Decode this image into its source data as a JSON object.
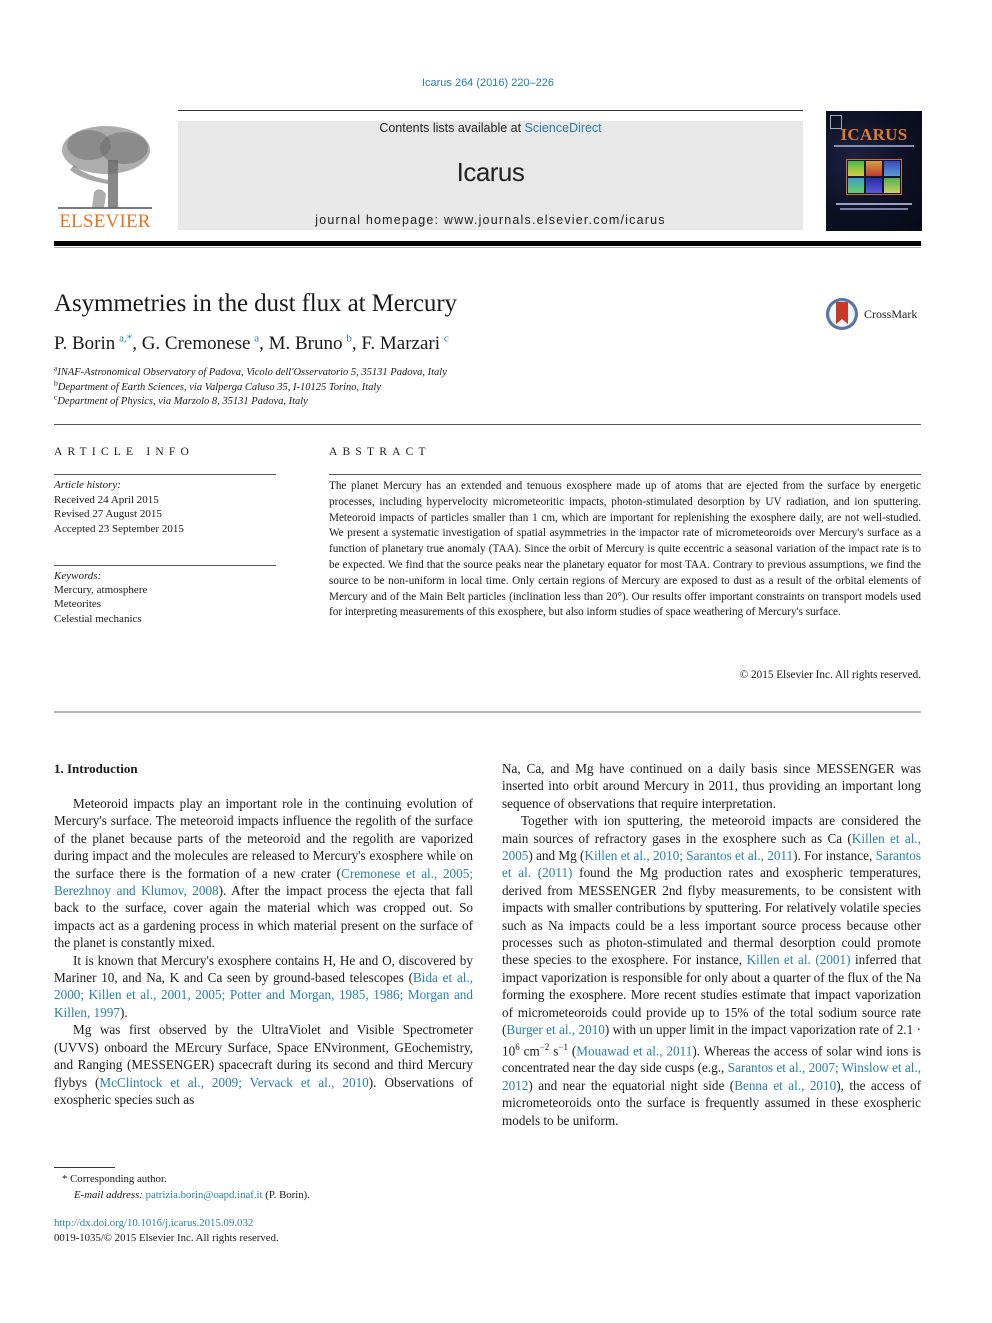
{
  "header": {
    "citation": "Icarus 264 (2016) 220–226",
    "contents_prefix": "Contents lists available at ",
    "contents_link": "ScienceDirect",
    "journal_name": "Icarus",
    "homepage": "journal homepage: www.journals.elsevier.com/icarus",
    "publisher_logo_text": "ELSEVIER",
    "cover_title": "ICARUS",
    "colors": {
      "link": "#2a7fa8",
      "elsevier_orange": "#e9711c",
      "banner_bg": "#e8e8e8"
    }
  },
  "article": {
    "title": "Asymmetries in the dust flux at Mercury",
    "crossmark_label": "CrossMark",
    "authors": [
      {
        "name": "P. Borin",
        "sup": "a,*"
      },
      {
        "name": "G. Cremonese",
        "sup": "a"
      },
      {
        "name": "M. Bruno",
        "sup": "b"
      },
      {
        "name": "F. Marzari",
        "sup": "c"
      }
    ],
    "affiliations": [
      {
        "key": "a",
        "text": "INAF-Astronomical Observatory of Padova, Vicolo dell'Osservatorio 5, 35131 Padova, Italy"
      },
      {
        "key": "b",
        "text": "Department of Earth Sciences, via Valperga Caluso 35, I-10125 Torino, Italy"
      },
      {
        "key": "c",
        "text": "Department of Physics, via Marzolo 8, 35131 Padova, Italy"
      }
    ]
  },
  "article_info": {
    "heading": "ARTICLE INFO",
    "history_label": "Article history:",
    "history": [
      "Received 24 April 2015",
      "Revised 27 August 2015",
      "Accepted 23 September 2015"
    ],
    "keywords_label": "Keywords:",
    "keywords": [
      "Mercury, atmosphere",
      "Meteorites",
      "Celestial mechanics"
    ]
  },
  "abstract": {
    "heading": "ABSTRACT",
    "text": "The planet Mercury has an extended and tenuous exosphere made up of atoms that are ejected from the surface by energetic processes, including hypervelocity micrometeoritic impacts, photon-stimulated des­orption by UV radiation, and ion sputtering. Meteoroid impacts of particles smaller than 1 cm, which are important for replenishing the exosphere daily, are not well-studied. We present a systematic investiga­tion of spatial asymmetries in the impactor rate of micrometeoroids over Mercury's surface as a function of planetary true anomaly (TAA). Since the orbit of Mercury is quite eccentric a seasonal variation of the impact rate is to be expected. We find that the source peaks near the planetary equator for most TAA. Contrary to previous assumptions, we find the source to be non-uniform in local time. Only certain regions of Mercury are exposed to dust as a result of the orbital elements of Mercury and of the Main Belt particles (inclination less than 20°). Our results offer important constraints on transport models used for interpreting measurements of this exosphere, but also inform studies of space weathering of Mercury's surface.",
    "copyright": "© 2015 Elsevier Inc. All rights reserved."
  },
  "body": {
    "section_heading": "1. Introduction",
    "left": {
      "p1": [
        "Meteoroid impacts play an important role in the continuing evolution of Mercury's surface. The meteoroid impacts influence the regolith of the surface of the planet because parts of the mete­oroid and the regolith are vaporized during impact and the mole­cules are released to Mercury's exosphere while on the surface there is the formation of a new crater (",
        "Cremonese et al., 2005; Berezhnoy and Klumov, 2008",
        "). After the impact process the ejecta that fall back to the surface, cover again the material which was cropped out. So impacts act as a gardening process in which mate­rial present on the surface of the planet is constantly mixed."
      ],
      "p2": [
        "It is known that Mercury's exosphere contains H, He and O, dis­covered by Mariner 10, and Na, K and Ca seen by ground-based telescopes (",
        "Bida et al., 2000; Killen et al., 2001, 2005; Potter and Morgan, 1985, 1986; Morgan and Killen, 1997",
        ")."
      ],
      "p3": [
        "Mg was first observed by the UltraViolet and Visible Spectrom­eter (UVVS) onboard the MErcury Surface, Space ENvironment, GEochemistry, and Ranging (MESSENGER) spacecraft during its second and third Mercury flybys (",
        "McClintock et al., 2009; Vervack et al., 2010",
        "). Observations of exospheric species such as"
      ]
    },
    "right": {
      "p1": "Na, Ca, and Mg have continued on a daily basis since MESSENGER was inserted into orbit around Mercury in 2011, thus providing an important long sequence of observations that require interpretation.",
      "p2": {
        "t1": "Together with ion sputtering, the meteoroid impacts are consid­ered the main sources of refractory gases in the exosphere such as Ca (",
        "l1": "Killen et al., 2005",
        "t2": ") and Mg (",
        "l2": "Killen et al., 2010; Sarantos et al., 2011",
        "t3": "). For instance, ",
        "l3": "Sarantos et al. (2011)",
        "t4": " found the Mg production rates and exospheric temperatures, derived from MESSENGER 2nd flyby measurements, to be consistent with impacts with smaller contributions by sputtering. For relatively volatile species such as Na impacts could be a less important source process because other processes such as photon-stimulated and thermal desorption could promote these species to the exosphere. For instance, ",
        "l4": "Killen et al. (2001)",
        "t5": " inferred that impact vaporization is responsible for only about a quarter of the flux of the Na forming the exosphere. More recent studies estimate that impact vaporization of micromete­oroids could provide up to 15% of the total sodium source rate (",
        "l5": "Burger et al., 2010",
        "t6": ") with un upper limit in the impact vaporization rate of 2.1 · 10",
        "exp1": "6",
        "t7": " cm",
        "exp2": "−2",
        "t8": " s",
        "exp3": "−1",
        "t9": " (",
        "l6": "Mouawad et al., 2011",
        "t10": "). Whereas the access of solar wind ions is concentrated near the day side cusps (e.g., ",
        "l7": "Sarantos et al., 2007; Winslow et al., 2012",
        "t11": ") and near the equa­torial night side (",
        "l8": "Benna et al., 2010",
        "t12": "), the access of micrometeoroids onto the surface is frequently assumed in these exospheric models to be uniform."
      }
    }
  },
  "footnotes": {
    "star": "* Corresponding author.",
    "email_label": "E-mail address: ",
    "email": "patrizia.borin@oapd.inaf.it",
    "email_suffix": " (P. Borin).",
    "doi": "http://dx.doi.org/10.1016/j.icarus.2015.09.032",
    "issn": "0019-1035/© 2015 Elsevier Inc. All rights reserved."
  }
}
